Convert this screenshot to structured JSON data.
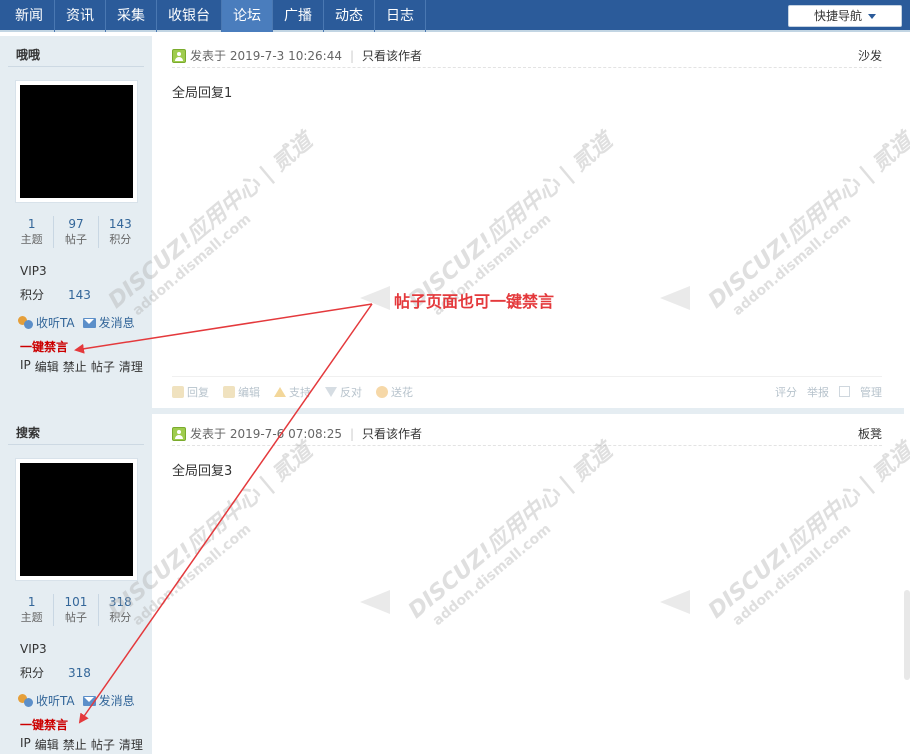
{
  "nav": {
    "items": [
      "新闻",
      "资讯",
      "采集",
      "收银台",
      "论坛",
      "广播",
      "动态",
      "日志"
    ],
    "active_index": 4,
    "quick_nav": "快捷导航"
  },
  "posts": [
    {
      "username": "哦哦",
      "stats": [
        {
          "num": "1",
          "label": "主题"
        },
        {
          "num": "97",
          "label": "帖子"
        },
        {
          "num": "143",
          "label": "积分"
        }
      ],
      "level": "VIP3",
      "credit_label": "积分",
      "credit_value": "143",
      "follow": "收听TA",
      "message": "发消息",
      "ban": "一键禁言",
      "mod_links": [
        "IP",
        "编辑",
        "禁止",
        "帖子",
        "清理"
      ],
      "posted": "发表于 2019-7-3 10:26:44",
      "only_author": "只看该作者",
      "floor": "沙发",
      "content": "全局回复1",
      "footer": {
        "reply": "回复",
        "edit": "编辑",
        "support": "支持",
        "oppose": "反对",
        "flower": "送花",
        "rate": "评分",
        "report": "举报",
        "manage": "管理"
      }
    },
    {
      "username": "搜索",
      "stats": [
        {
          "num": "1",
          "label": "主题"
        },
        {
          "num": "101",
          "label": "帖子"
        },
        {
          "num": "318",
          "label": "积分"
        }
      ],
      "level": "VIP3",
      "credit_label": "积分",
      "credit_value": "318",
      "follow": "收听TA",
      "message": "发消息",
      "ban": "一键禁言",
      "mod_links": [
        "IP",
        "编辑",
        "禁止",
        "帖子",
        "清理"
      ],
      "posted": "发表于 2019-7-6 07:08:25",
      "only_author": "只看该作者",
      "floor": "板凳",
      "content": "全局回复3"
    }
  ],
  "annotation": "帖子页面也可一键禁言",
  "watermark": {
    "line1": "DISCUZ!应用中心 | 贰道",
    "line2": "addon.dismall.com"
  },
  "colors": {
    "nav_bg": "#2b5b9a",
    "side_bg": "#e5edf2",
    "link": "#336699",
    "ban": "#cc0000",
    "annotation": "#e4393c"
  }
}
